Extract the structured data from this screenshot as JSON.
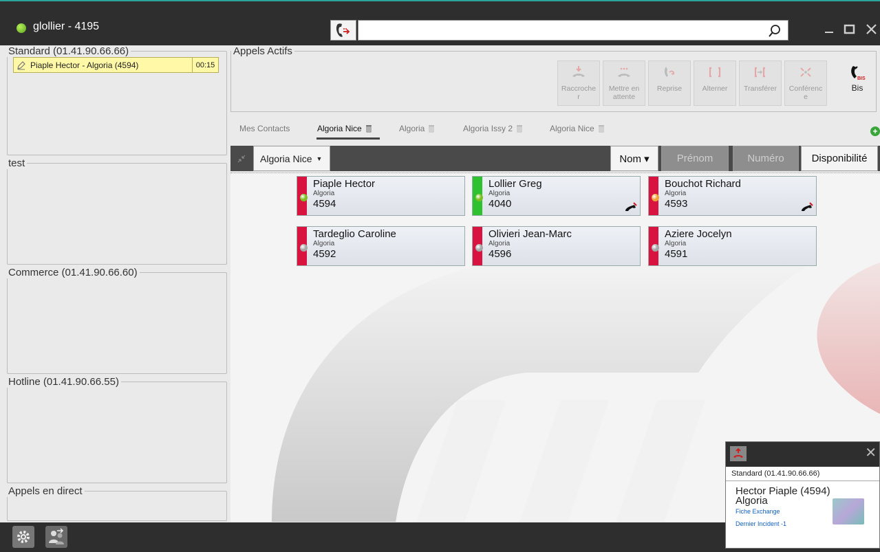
{
  "window": {
    "user": "glollier - 4195",
    "status_color": "#6fbf25",
    "search_placeholder": "",
    "icons": [
      "dial-icon",
      "search-icon",
      "minimize-icon",
      "maximize-icon",
      "close-icon"
    ]
  },
  "left": {
    "groups": [
      {
        "title": "Standard (01.41.90.66.66)",
        "calls": [
          {
            "label": "Piaple Hector - Algoria (4594)",
            "timer": "00:15"
          }
        ]
      },
      {
        "title": "test",
        "calls": []
      },
      {
        "title": "Commerce (01.41.90.66.60)",
        "calls": []
      },
      {
        "title": "Hotline (01.41.90.66.55)",
        "calls": []
      },
      {
        "title": "Appels en direct",
        "calls": []
      }
    ]
  },
  "actifs": {
    "title": "Appels Actifs",
    "tools": [
      {
        "label": "Raccroche\nr",
        "enabled": false,
        "icon": "hangup-icon"
      },
      {
        "label": "Mettre en\nattente",
        "enabled": false,
        "icon": "hold-icon"
      },
      {
        "label": "Reprise",
        "enabled": false,
        "icon": "resume-icon"
      },
      {
        "label": "Alterner",
        "enabled": false,
        "icon": "alternate-icon"
      },
      {
        "label": "Transférer",
        "enabled": false,
        "icon": "transfer-icon"
      },
      {
        "label": "Conférenc\ne",
        "enabled": false,
        "icon": "conference-icon"
      },
      {
        "label": "Bis",
        "enabled": true,
        "icon": "redial-icon",
        "badge": "BIS"
      }
    ]
  },
  "tabs": [
    {
      "label": "Mes Contacts",
      "active": false,
      "trash": false
    },
    {
      "label": "Algoria Nice",
      "active": true,
      "trash": true
    },
    {
      "label": "Algoria",
      "active": false,
      "trash": true
    },
    {
      "label": "Algoria Issy 2",
      "active": false,
      "trash": true
    },
    {
      "label": "Algoria Nice",
      "active": false,
      "trash": true
    }
  ],
  "contacts_toolbar": {
    "group": "Algoria Nice",
    "sort": [
      {
        "label": "Nom ▾",
        "active": true
      },
      {
        "label": "Prénom",
        "active": false
      },
      {
        "label": "Numéro",
        "active": false
      },
      {
        "label": "Disponibilité",
        "active": true
      }
    ]
  },
  "contacts": [
    {
      "name": "Piaple Hector",
      "group": "Algoria",
      "number": "4594",
      "bar": "#d8133f",
      "dot": "#7bbf22",
      "phone": false
    },
    {
      "name": "Lollier Greg",
      "group": "Algoria",
      "number": "4040",
      "bar": "#2fc12f",
      "dot": "#7bbf22",
      "phone": true
    },
    {
      "name": "Bouchot Richard",
      "group": "Algoria",
      "number": "4593",
      "bar": "#d8133f",
      "dot": "#f0a23a",
      "phone": true
    },
    {
      "name": "Tardeglio Caroline",
      "group": "Algoria",
      "number": "4592",
      "bar": "#d8133f",
      "dot": "#a7a7a7",
      "phone": false
    },
    {
      "name": "Olivieri Jean-Marc",
      "group": "Algoria",
      "number": "4596",
      "bar": "#d8133f",
      "dot": "#a7a7a7",
      "phone": false
    },
    {
      "name": "Aziere Jocelyn",
      "group": "Algoria",
      "number": "4591",
      "bar": "#d8133f",
      "dot": "#a7a7a7",
      "phone": false
    }
  ],
  "popup": {
    "line": "Standard (01.41.90.66.66)",
    "caller": "Hector Piaple (4594)",
    "company": "Algoria",
    "links": [
      "Fiche Exchange",
      "Dernier Incident -1"
    ]
  },
  "bottom": {
    "icons": [
      "settings-icon",
      "transfer-users-icon"
    ]
  }
}
